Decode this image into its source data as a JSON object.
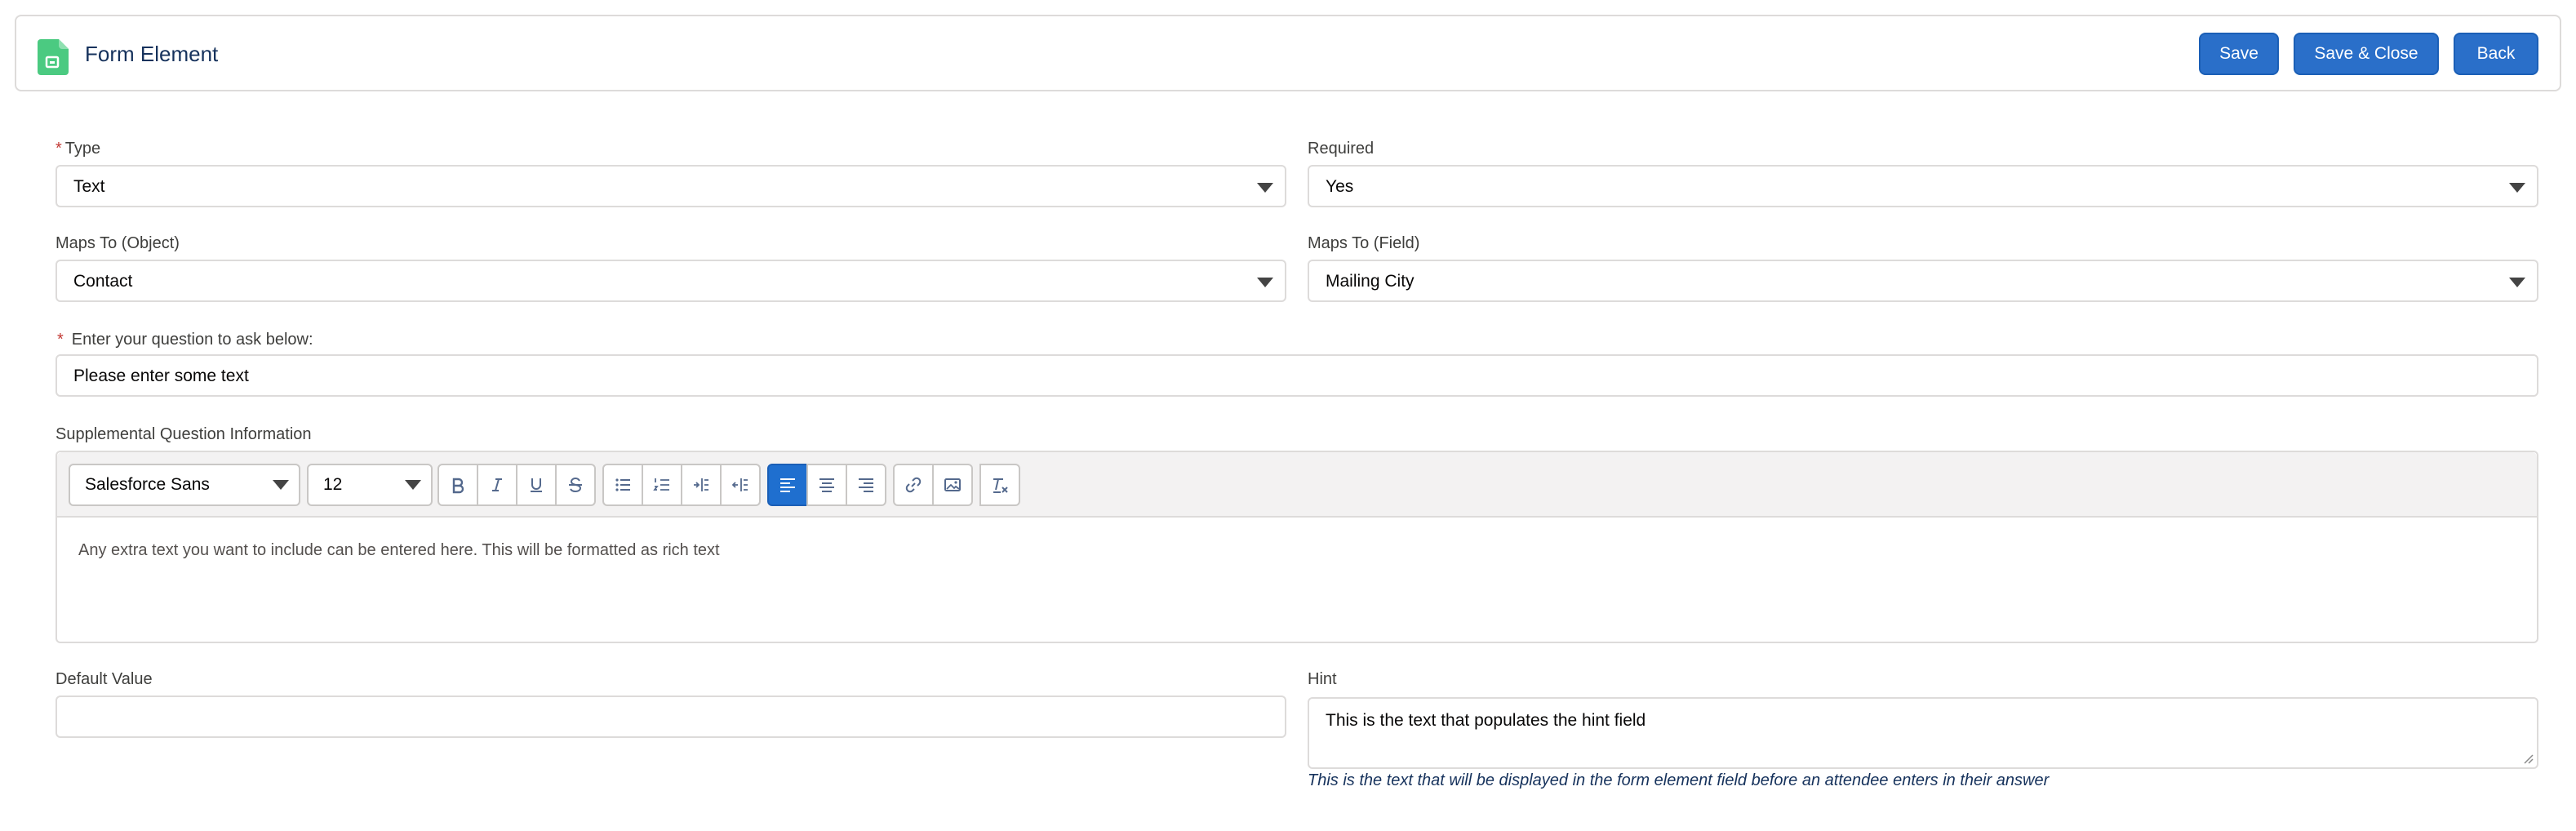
{
  "header": {
    "title": "Form Element",
    "icon": "form-element-icon",
    "buttons": {
      "save": "Save",
      "save_close": "Save & Close",
      "back": "Back"
    }
  },
  "fields": {
    "type": {
      "label": "Type",
      "required_marker": "*",
      "value": "Text"
    },
    "required": {
      "label": "Required",
      "value": "Yes"
    },
    "maps_object": {
      "label": "Maps To (Object)",
      "value": "Contact"
    },
    "maps_field": {
      "label": "Maps To (Field)",
      "value": "Mailing City"
    },
    "question": {
      "label": "Enter your question to ask below:",
      "required_marker": "*",
      "value": "Please enter some text"
    },
    "supplemental": {
      "label": "Supplemental Question Information",
      "font": "Salesforce Sans",
      "size": "12",
      "body": "Any extra text you want to include can be entered here. This will be formatted as rich text",
      "toolbar": [
        "bold-icon",
        "italic-icon",
        "underline-icon",
        "strikethrough-icon",
        "bullet-list-icon",
        "numbered-list-icon",
        "indent-icon",
        "outdent-icon",
        "align-left-icon",
        "align-center-icon",
        "align-right-icon",
        "link-icon",
        "image-icon",
        "clear-formatting-icon"
      ],
      "active_align": "left"
    },
    "default_value": {
      "label": "Default Value",
      "value": ""
    },
    "hint": {
      "label": "Hint",
      "value": "This is the text that populates the hint field",
      "help": "This is the text that will be displayed in the form element field before an attendee enters in their answer"
    }
  },
  "colors": {
    "brand": "#2a6fc9",
    "required": "#c23934",
    "icon_green": "#4bca81"
  }
}
